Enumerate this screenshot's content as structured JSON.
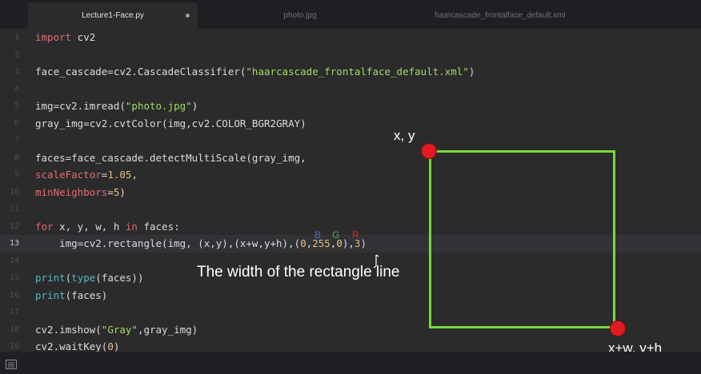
{
  "tabs": [
    {
      "label": "Lecture1-Face.py",
      "active": true,
      "modified": true
    },
    {
      "label": "photo.jpg"
    },
    {
      "label": "haarcascade_frontalface_default.xml"
    }
  ],
  "lines": [
    {
      "n": "1",
      "code": "import cv2"
    },
    {
      "n": "2",
      "code": ""
    },
    {
      "n": "3",
      "code": "face_cascade=cv2.CascadeClassifier(\"haarcascade_frontalface_default.xml\")"
    },
    {
      "n": "4",
      "code": ""
    },
    {
      "n": "5",
      "code": "img=cv2.imread(\"photo.jpg\")"
    },
    {
      "n": "6",
      "code": "gray_img=cv2.cvtColor(img,cv2.COLOR_BGR2GRAY)"
    },
    {
      "n": "7",
      "code": ""
    },
    {
      "n": "8",
      "code": "faces=face_cascade.detectMultiScale(gray_img,"
    },
    {
      "n": "9",
      "code": "scaleFactor=1.05,"
    },
    {
      "n": "10",
      "code": "minNeighbors=5)"
    },
    {
      "n": "11",
      "code": ""
    },
    {
      "n": "12",
      "code": "for x, y, w, h in faces:"
    },
    {
      "n": "13",
      "code": "    img=cv2.rectangle(img, (x,y),(x+w,y+h),(0,255,0),3)"
    },
    {
      "n": "14",
      "code": ""
    },
    {
      "n": "15",
      "code": "print(type(faces))"
    },
    {
      "n": "16",
      "code": "print(faces)"
    },
    {
      "n": "17",
      "code": ""
    },
    {
      "n": "18",
      "code": "cv2.imshow(\"Gray\",gray_img)"
    },
    {
      "n": "19",
      "code": "cv2.waitKey(0)"
    }
  ],
  "current_line": "13",
  "annotations": {
    "b": "B",
    "g": "G",
    "r": "R",
    "width_note": "The width of the rectangle line",
    "top_left": "x, y",
    "bottom_right": "x+w, y+h"
  },
  "colors": {
    "b": "#3f6fd8",
    "g": "#4caf50",
    "r": "#d93025",
    "rect": "#77d93b",
    "corner": "#e01b24"
  },
  "icons": {
    "statusbar": "file-status-icon",
    "cursor": "mouse-cursor-icon"
  }
}
